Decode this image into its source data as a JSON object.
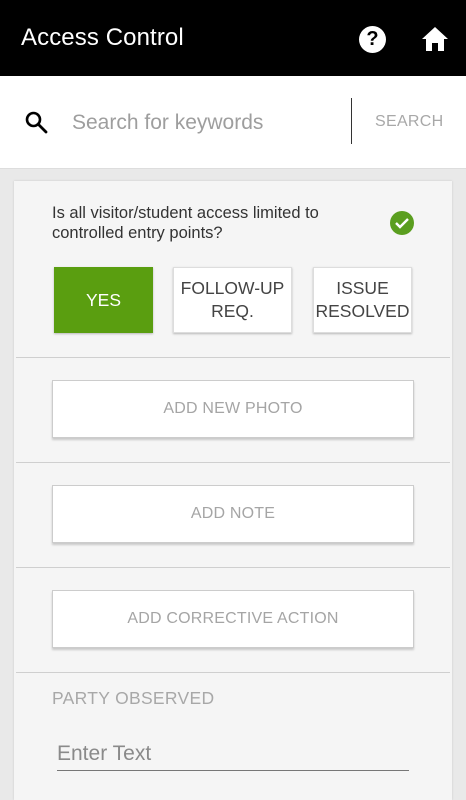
{
  "app_bar": {
    "title": "Access Control",
    "help_icon_glyph": "?",
    "help_icon": "help-circle-icon",
    "home_icon": "home-icon"
  },
  "search": {
    "placeholder": "Search for keywords",
    "value": "",
    "button_label": "SEARCH",
    "icon": "search-icon"
  },
  "question": {
    "text": "Is all visitor/student access limited to controlled entry points?",
    "status_icon": "check-circle-icon",
    "status_color": "#5a9e1f"
  },
  "options": {
    "yes_label": "YES",
    "followup_label_line1": "FOLLOW-UP",
    "followup_label_line2": "REQ.",
    "resolved_label_line1": "ISSUE",
    "resolved_label_line2": "RESOLVED",
    "selected": "YES",
    "selected_color": "#5a9e10"
  },
  "actions": {
    "add_photo_label": "ADD NEW PHOTO",
    "add_note_label": "ADD NOTE",
    "add_corrective_label": "ADD CORRECTIVE ACTION"
  },
  "party_observed": {
    "label": "PARTY OBSERVED",
    "placeholder": "Enter Text",
    "value": ""
  }
}
